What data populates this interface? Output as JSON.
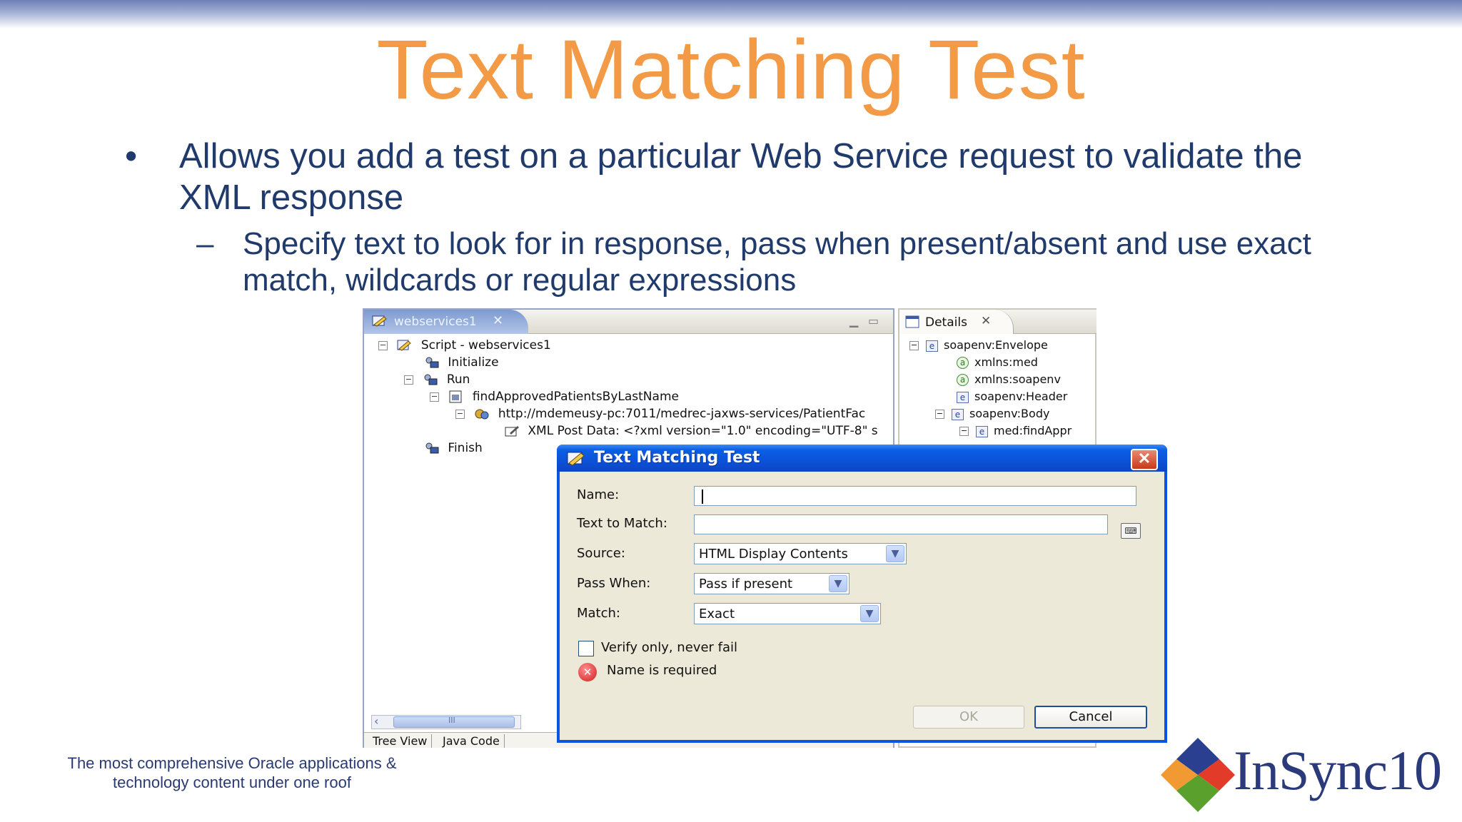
{
  "slide": {
    "title": "Text Matching Test",
    "bullet1": "Allows you add a test on a particular Web Service request to validate the XML response",
    "bullet2": "Specify text to look for in response, pass when present/absent and use exact match, wildcards or regular expressions",
    "bullet_symbol": "•",
    "dash_symbol": "–",
    "tagline": "The most comprehensive Oracle applications & technology content under one roof",
    "logo_text": "InSync10",
    "colors": {
      "title": "#f29a45",
      "text": "#1f3a6b",
      "dialog_title": "#0b4fd6"
    }
  },
  "editor": {
    "tab_label": "webservices1",
    "tab_close": "✕",
    "tree": [
      {
        "label": "Script - webservices1",
        "icon": "script-icon"
      },
      {
        "label": "Initialize",
        "icon": "step-icon"
      },
      {
        "label": "Run",
        "icon": "step-icon"
      },
      {
        "label": "findApprovedPatientsByLastName",
        "icon": "page-icon"
      },
      {
        "label": "http://mdemeusy-pc:7011/medrec-jaxws-services/PatientFac",
        "icon": "web-request-icon"
      },
      {
        "label": "XML Post Data: <?xml version=\"1.0\" encoding=\"UTF-8\" s",
        "icon": "post-data-icon"
      },
      {
        "label": "Finish",
        "icon": "step-icon"
      }
    ],
    "bottom_tabs": [
      "Tree View",
      "Java Code"
    ],
    "scroll_grip": "III"
  },
  "details": {
    "tab_label": "Details",
    "tab_close": "✕",
    "tree": [
      {
        "badge": "e",
        "label": "soapenv:Envelope"
      },
      {
        "badge": "a",
        "label": "xmlns:med"
      },
      {
        "badge": "a",
        "label": "xmlns:soapenv"
      },
      {
        "badge": "e",
        "label": "soapenv:Header"
      },
      {
        "badge": "e",
        "label": "soapenv:Body"
      },
      {
        "badge": "e",
        "label": "med:findAppr"
      }
    ]
  },
  "dialog": {
    "title": "Text Matching Test",
    "close": "✕",
    "name_label": "Name:",
    "name_value": "",
    "text_label": "Text to Match:",
    "text_value": "",
    "source_label": "Source:",
    "source_value": "HTML Display Contents",
    "pass_label": "Pass When:",
    "pass_value": "Pass if present",
    "match_label": "Match:",
    "match_value": "Exact",
    "verify_label": "Verify only, never fail",
    "verify_checked": false,
    "error_text": "Name is required",
    "ok_label": "OK",
    "cancel_label": "Cancel"
  }
}
